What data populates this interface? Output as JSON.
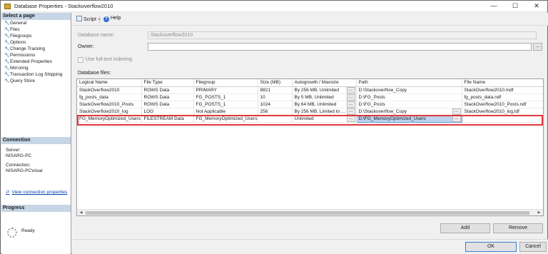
{
  "window": {
    "title": "Database Properties - Stackoverflow2010",
    "minimize": "—",
    "maximize": "☐",
    "close": "✕"
  },
  "left": {
    "select_page_header": "Select a page",
    "pages": [
      {
        "label": "General"
      },
      {
        "label": "Files"
      },
      {
        "label": "Filegroups"
      },
      {
        "label": "Options"
      },
      {
        "label": "Change Tracking"
      },
      {
        "label": "Permissions"
      },
      {
        "label": "Extended Properties"
      },
      {
        "label": "Mirroring"
      },
      {
        "label": "Transaction Log Shipping"
      },
      {
        "label": "Query Store"
      }
    ],
    "connection_header": "Connection",
    "server_label": "Server:",
    "server_value": "NISARG-PC",
    "connection_label": "Connection:",
    "connection_value": "NISARG-PC\\nisar",
    "view_connection_properties": "View connection properties",
    "progress_header": "Progress",
    "progress_status": "Ready"
  },
  "toolbar": {
    "script_label": "Script",
    "help_label": "Help"
  },
  "form": {
    "database_name_label": "Database name:",
    "database_name_value": "Stackoverflow2010",
    "owner_label": "Owner:",
    "owner_value": "",
    "owner_browse": "...",
    "fulltext_label": "Use full-text indexing",
    "database_files_label": "Database files:"
  },
  "grid": {
    "columns": [
      "Logical Name",
      "File Type",
      "Filegroup",
      "Size (MB)",
      "Autogrowth / Maxsize",
      "Path",
      "File Name"
    ],
    "rows": [
      {
        "logical": "StackOverflow2010",
        "type": "ROWS Data",
        "filegroup": "PRIMARY",
        "size": "8821",
        "autogrowth": "By 256 MB, Unlimited",
        "path": "D:\\Stackoverflow_Copy",
        "file": "StackOverflow2010.mdf"
      },
      {
        "logical": "fg_posts_data",
        "type": "ROWS Data",
        "filegroup": "FG_POSTS_1",
        "size": "10",
        "autogrowth": "By 5 MB, Unlimited",
        "path": "D:\\FG_Posts",
        "file": "fg_posts_data.ndf"
      },
      {
        "logical": "StackOverflow2010_Posts",
        "type": "ROWS Data",
        "filegroup": "FG_POSTS_1",
        "size": "1024",
        "autogrowth": "By 64 MB, Unlimited",
        "path": "D:\\FG_Posts",
        "file": "StackOverflow2010_Posts.ndf"
      },
      {
        "logical": "StackOverflow2010_log",
        "type": "LOG",
        "filegroup": "Not Applicable",
        "size": "256",
        "autogrowth": "By 256 MB, Limited to ...",
        "path": "D:\\Stackoverflow_Copy",
        "file": "StackOverflow2010_log.ldf"
      },
      {
        "logical": "FG_MemoryOptimized_Users",
        "type": "FILESTREAM Data",
        "filegroup": "FG_MemoryOptimized_Users",
        "size": "",
        "autogrowth": "Unlimited",
        "path": "D:\\FG_MemoryOptimized_Users",
        "file": ""
      }
    ],
    "browse": "..."
  },
  "buttons": {
    "add": "Add",
    "remove": "Remove",
    "ok": "OK",
    "cancel": "Cancel"
  },
  "colors": {
    "highlight_border": "#e2373d",
    "selected_cell": "#bcd3ee",
    "section_header": "#c7d6e6"
  }
}
